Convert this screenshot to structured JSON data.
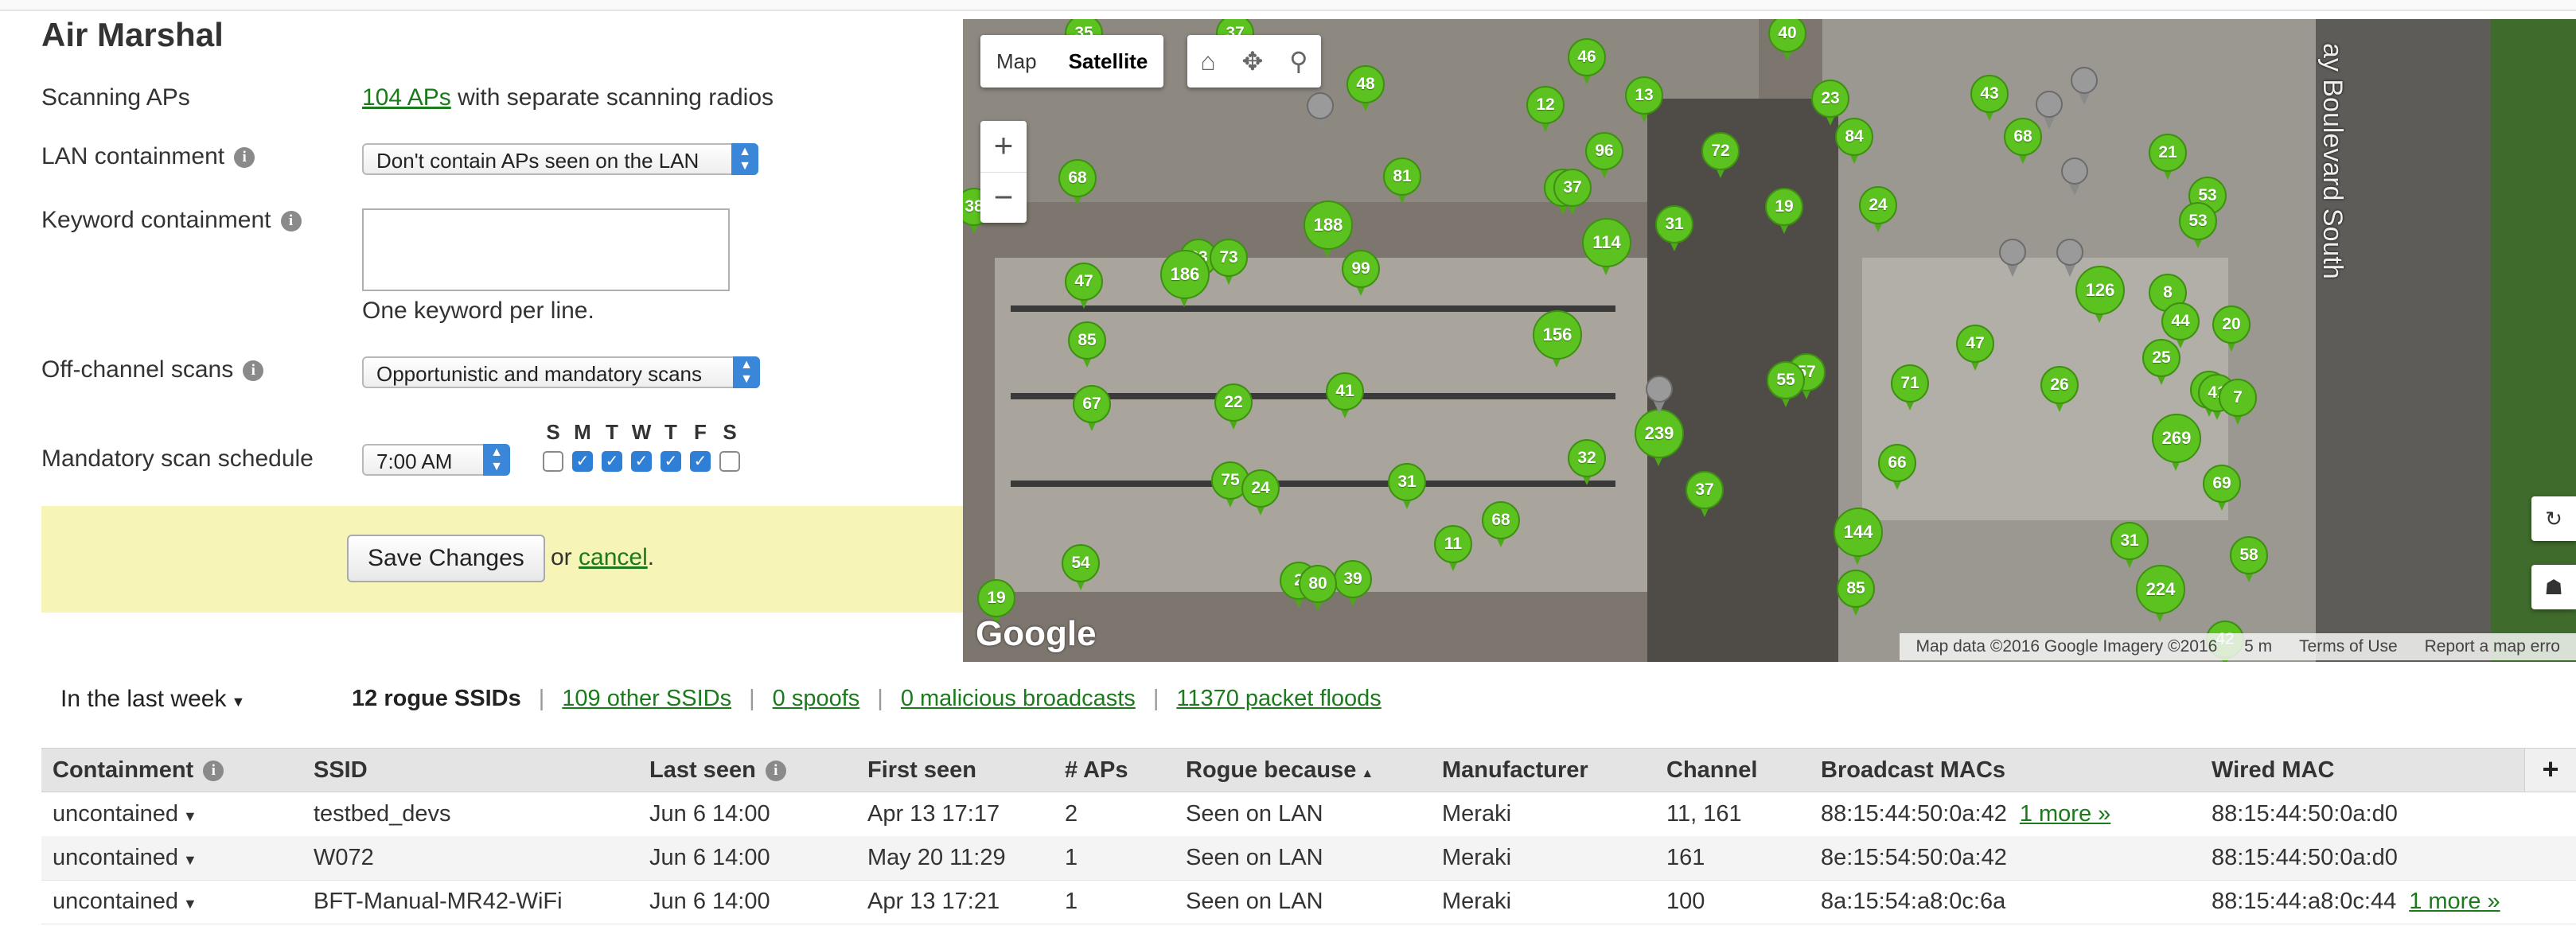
{
  "title": "Air Marshal",
  "settings": {
    "scanning_aps": {
      "label": "Scanning APs",
      "link": "104 APs",
      "suffix": " with separate scanning radios"
    },
    "lan_containment": {
      "label": "LAN containment",
      "value": "Don't contain APs seen on the LAN"
    },
    "keyword_containment": {
      "label": "Keyword containment",
      "textarea_value": "",
      "hint": "One keyword per line."
    },
    "off_channel": {
      "label": "Off-channel scans",
      "value": "Opportunistic and mandatory scans"
    },
    "schedule": {
      "label": "Mandatory scan schedule",
      "time": "7:00 AM",
      "days": [
        {
          "letter": "S",
          "checked": false
        },
        {
          "letter": "M",
          "checked": true
        },
        {
          "letter": "T",
          "checked": true
        },
        {
          "letter": "W",
          "checked": true
        },
        {
          "letter": "T",
          "checked": true
        },
        {
          "letter": "F",
          "checked": true
        },
        {
          "letter": "S",
          "checked": false
        }
      ]
    },
    "save_label": "Save Changes",
    "or_text": " or ",
    "cancel_label": "cancel",
    "period": "."
  },
  "map": {
    "type_map": "Map",
    "type_satellite": "Satellite",
    "zoom_in": "+",
    "zoom_out": "−",
    "google": "Google",
    "street": "ay Boulevard South",
    "attribution": {
      "data": "Map data ©2016 Google Imagery ©2016",
      "scale": "5 m",
      "terms": "Terms of Use",
      "report": "Report a map erro"
    },
    "pin_color": "#5bc21f",
    "pins": [
      "35",
      "37",
      "40",
      "46",
      "13",
      "12",
      "48",
      "23",
      "43",
      "68",
      "37",
      "68",
      "81",
      "96",
      "72",
      "84",
      "21",
      "53",
      "38",
      "188",
      "37",
      "114",
      "31",
      "19",
      "24",
      "53",
      "83",
      "73",
      "47",
      "99",
      "186",
      "126",
      "8",
      "44",
      "20",
      "85",
      "156",
      "57",
      "55",
      "47",
      "25",
      "26",
      "67",
      "22",
      "41",
      "99",
      "71",
      "41",
      "7",
      "269",
      "239",
      "32",
      "66",
      "69",
      "75",
      "24",
      "31",
      "37",
      "68",
      "144",
      "11",
      "31",
      "58",
      "54",
      "39",
      "2",
      "80",
      "19",
      "85",
      "224",
      "42"
    ]
  },
  "filters": {
    "time_range": "In the last week",
    "rogue_ssids": "12 rogue SSIDs",
    "other_ssids": "109 other SSIDs",
    "spoofs": "0 spoofs",
    "malicious": "0 malicious broadcasts",
    "floods": "11370 packet floods"
  },
  "table": {
    "headers": {
      "containment": "Containment",
      "ssid": "SSID",
      "last_seen": "Last seen",
      "first_seen": "First seen",
      "aps": "# APs",
      "rogue_because": "Rogue because",
      "manufacturer": "Manufacturer",
      "channel": "Channel",
      "broadcast_macs": "Broadcast MACs",
      "wired_mac": "Wired MAC",
      "add": "+"
    },
    "rows": [
      {
        "containment": "uncontained",
        "ssid": "testbed_devs",
        "last_seen": "Jun 6 14:00",
        "first_seen": "Apr 13 17:17",
        "aps": "2",
        "rogue": "Seen on LAN",
        "manufacturer": "Meraki",
        "channel": "11, 161",
        "bmac": "88:15:44:50:0a:42",
        "bmore": "1 more »",
        "wmac": "88:15:44:50:0a:d0",
        "wmore": ""
      },
      {
        "containment": "uncontained",
        "ssid": "W072",
        "last_seen": "Jun 6 14:00",
        "first_seen": "May 20 11:29",
        "aps": "1",
        "rogue": "Seen on LAN",
        "manufacturer": "Meraki",
        "channel": "161",
        "bmac": "8e:15:54:50:0a:42",
        "bmore": "",
        "wmac": "88:15:44:50:0a:d0",
        "wmore": ""
      },
      {
        "containment": "uncontained",
        "ssid": "BFT-Manual-MR42-WiFi",
        "last_seen": "Jun 6 14:00",
        "first_seen": "Apr 13 17:21",
        "aps": "1",
        "rogue": "Seen on LAN",
        "manufacturer": "Meraki",
        "channel": "100",
        "bmac": "8a:15:54:a8:0c:6a",
        "bmore": "",
        "wmac": "88:15:44:a8:0c:44",
        "wmore": "1 more »"
      }
    ]
  }
}
